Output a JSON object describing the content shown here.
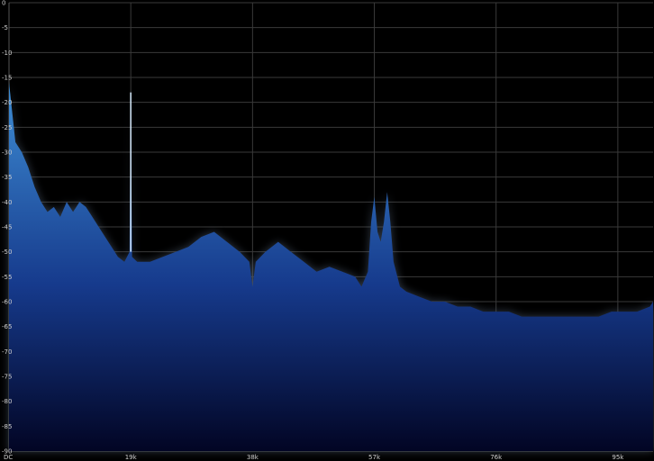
{
  "chart_data": {
    "type": "area",
    "title": "",
    "xlabel": "",
    "ylabel": "",
    "x_ticks": [
      {
        "value": 0,
        "label": "DC"
      },
      {
        "value": 19,
        "label": "19k"
      },
      {
        "value": 38,
        "label": "38k"
      },
      {
        "value": 57,
        "label": "57k"
      },
      {
        "value": 76,
        "label": "76k"
      },
      {
        "value": 95,
        "label": "95k"
      }
    ],
    "y_ticks": [
      0,
      -5,
      -10,
      -15,
      -20,
      -25,
      -30,
      -35,
      -40,
      -45,
      -50,
      -55,
      -60,
      -65,
      -70,
      -75,
      -80,
      -85,
      -90
    ],
    "xlim": [
      0,
      100.5
    ],
    "ylim": [
      -90,
      0
    ],
    "grid": true,
    "colors": {
      "background": "#000000",
      "grid": "#3a3a3a",
      "fill_top": "#3f8fd6",
      "fill_mid": "#163a8c",
      "fill_bottom": "#020524",
      "haze": "#5a6a80",
      "tone": "#d8ecff"
    },
    "series": [
      {
        "x": [
          0,
          1,
          2,
          3,
          4,
          5,
          6,
          7,
          8,
          9,
          10,
          11,
          12,
          13,
          14,
          15,
          16,
          17,
          18,
          18.8,
          19,
          19.2,
          20,
          22,
          24,
          26,
          28,
          30,
          32,
          34,
          36,
          37.5,
          38,
          38.5,
          40,
          42,
          44,
          46,
          48,
          50,
          52,
          54,
          55,
          56,
          56.5,
          57,
          57.5,
          58,
          58.5,
          59,
          59.5,
          60,
          61,
          62,
          64,
          66,
          68,
          70,
          72,
          74,
          76,
          78,
          80,
          82,
          84,
          86,
          88,
          90,
          92,
          94,
          96,
          98,
          100,
          100.5
        ],
        "values": [
          -16,
          -28,
          -30,
          -33,
          -37,
          -40,
          -42,
          -41,
          -43,
          -40,
          -42,
          -40,
          -41,
          -43,
          -45,
          -47,
          -49,
          -51,
          -52,
          -50,
          -18,
          -51,
          -52,
          -52,
          -51,
          -50,
          -49,
          -47,
          -46,
          -48,
          -50,
          -52,
          -57,
          -52,
          -50,
          -48,
          -50,
          -52,
          -54,
          -53,
          -54,
          -55,
          -57,
          -54,
          -44,
          -39,
          -46,
          -48,
          -44,
          -38,
          -44,
          -52,
          -57,
          -58,
          -59,
          -60,
          -60,
          -61,
          -61,
          -62,
          -62,
          -62,
          -63,
          -63,
          -63,
          -63,
          -63,
          -63,
          -63,
          -62,
          -62,
          -62,
          -61,
          -60
        ]
      }
    ]
  }
}
